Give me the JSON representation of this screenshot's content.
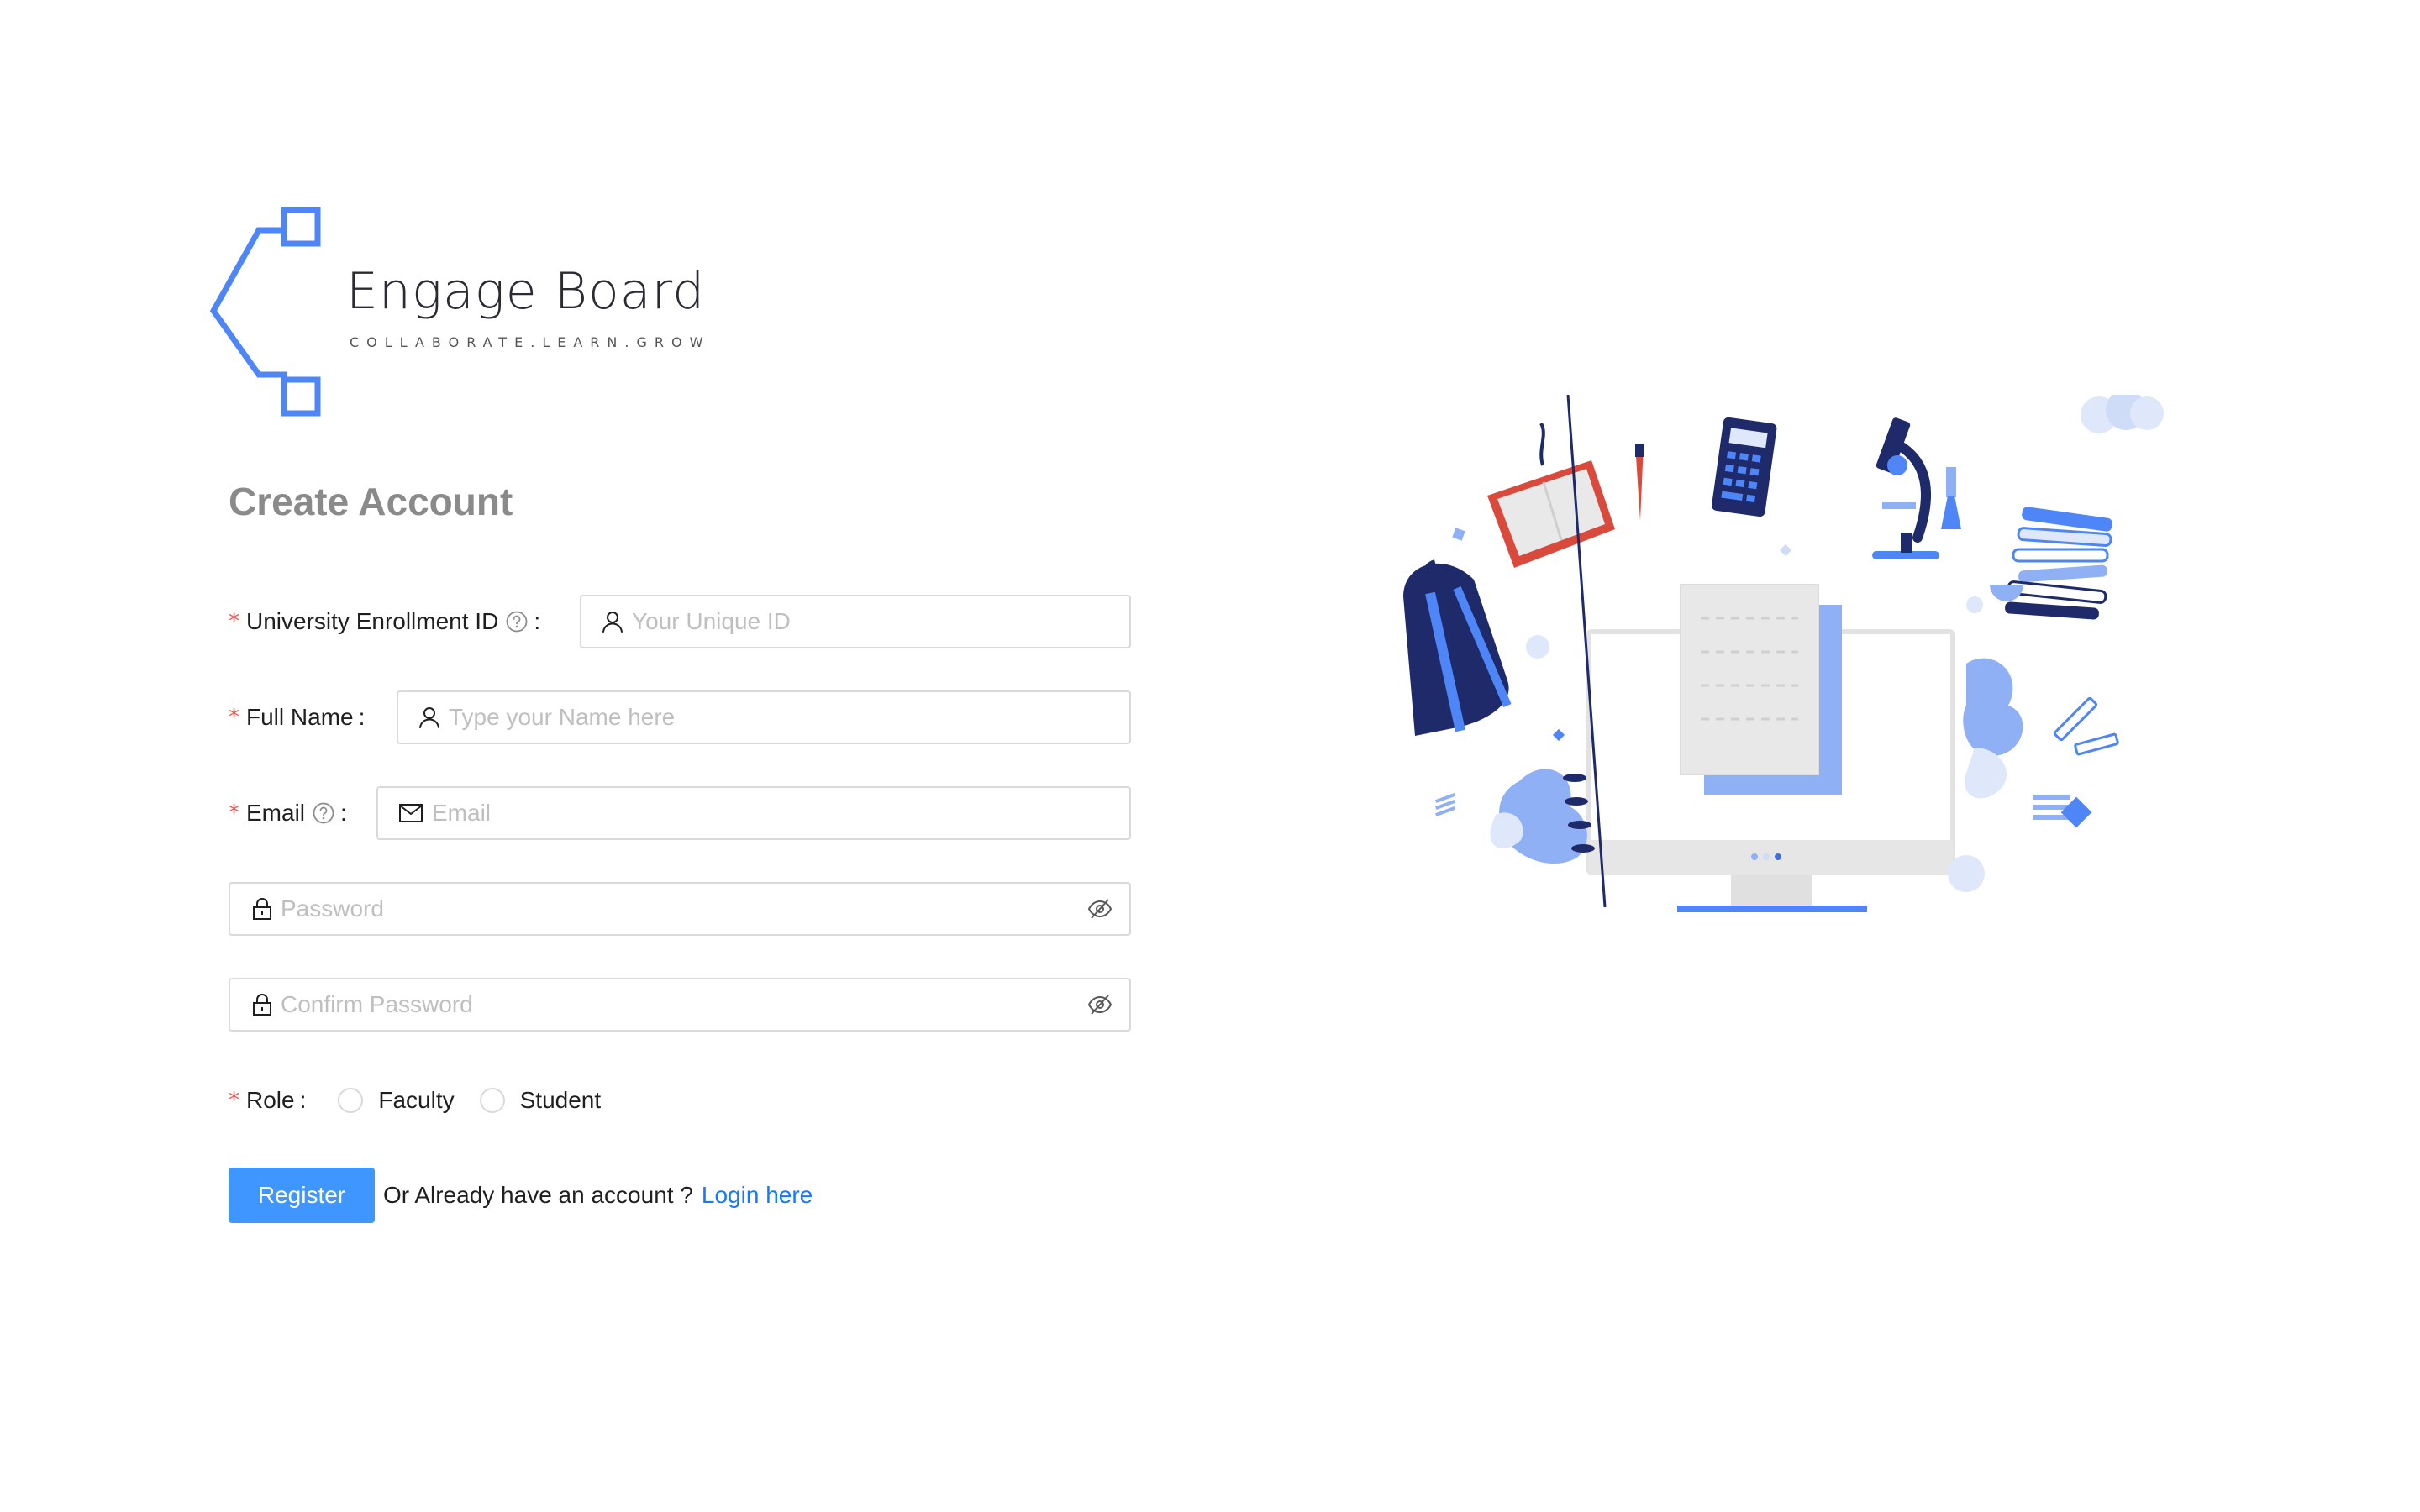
{
  "brand": {
    "name": "Engage Board",
    "tagline": "COLLABORATE.LEARN.GROW"
  },
  "heading": "Create Account",
  "form": {
    "enrollment": {
      "label": "University Enrollment ID",
      "placeholder": "Your Unique ID",
      "prefix_icon": "user-icon",
      "help_icon": "question-circle-icon"
    },
    "full_name": {
      "label": "Full Name",
      "placeholder": "Type your Name here",
      "prefix_icon": "user-icon"
    },
    "email": {
      "label": "Email",
      "placeholder": "Email",
      "prefix_icon": "mail-icon",
      "help_icon": "question-circle-icon"
    },
    "password": {
      "placeholder": "Password",
      "prefix_icon": "lock-icon",
      "suffix_icon": "eye-invisible-icon"
    },
    "confirm_password": {
      "placeholder": "Confirm Password",
      "prefix_icon": "lock-icon",
      "suffix_icon": "eye-invisible-icon"
    },
    "role": {
      "label": "Role",
      "options": [
        "Faculty",
        "Student"
      ],
      "selected": null
    },
    "colon": ":",
    "required_mark": "*"
  },
  "actions": {
    "register_label": "Register",
    "already_text": "Or Already have an account ?",
    "login_label": "Login here"
  },
  "colors": {
    "primary": "#4096ff",
    "link": "#1677ff",
    "required": "#ff4d4f",
    "heading": "#8a8a8a",
    "logo_blue": "#4f86f7",
    "border": "#d9d9d9",
    "placeholder": "#bfbfbf"
  },
  "illustration": {
    "icon": "education-computer-illustration"
  }
}
